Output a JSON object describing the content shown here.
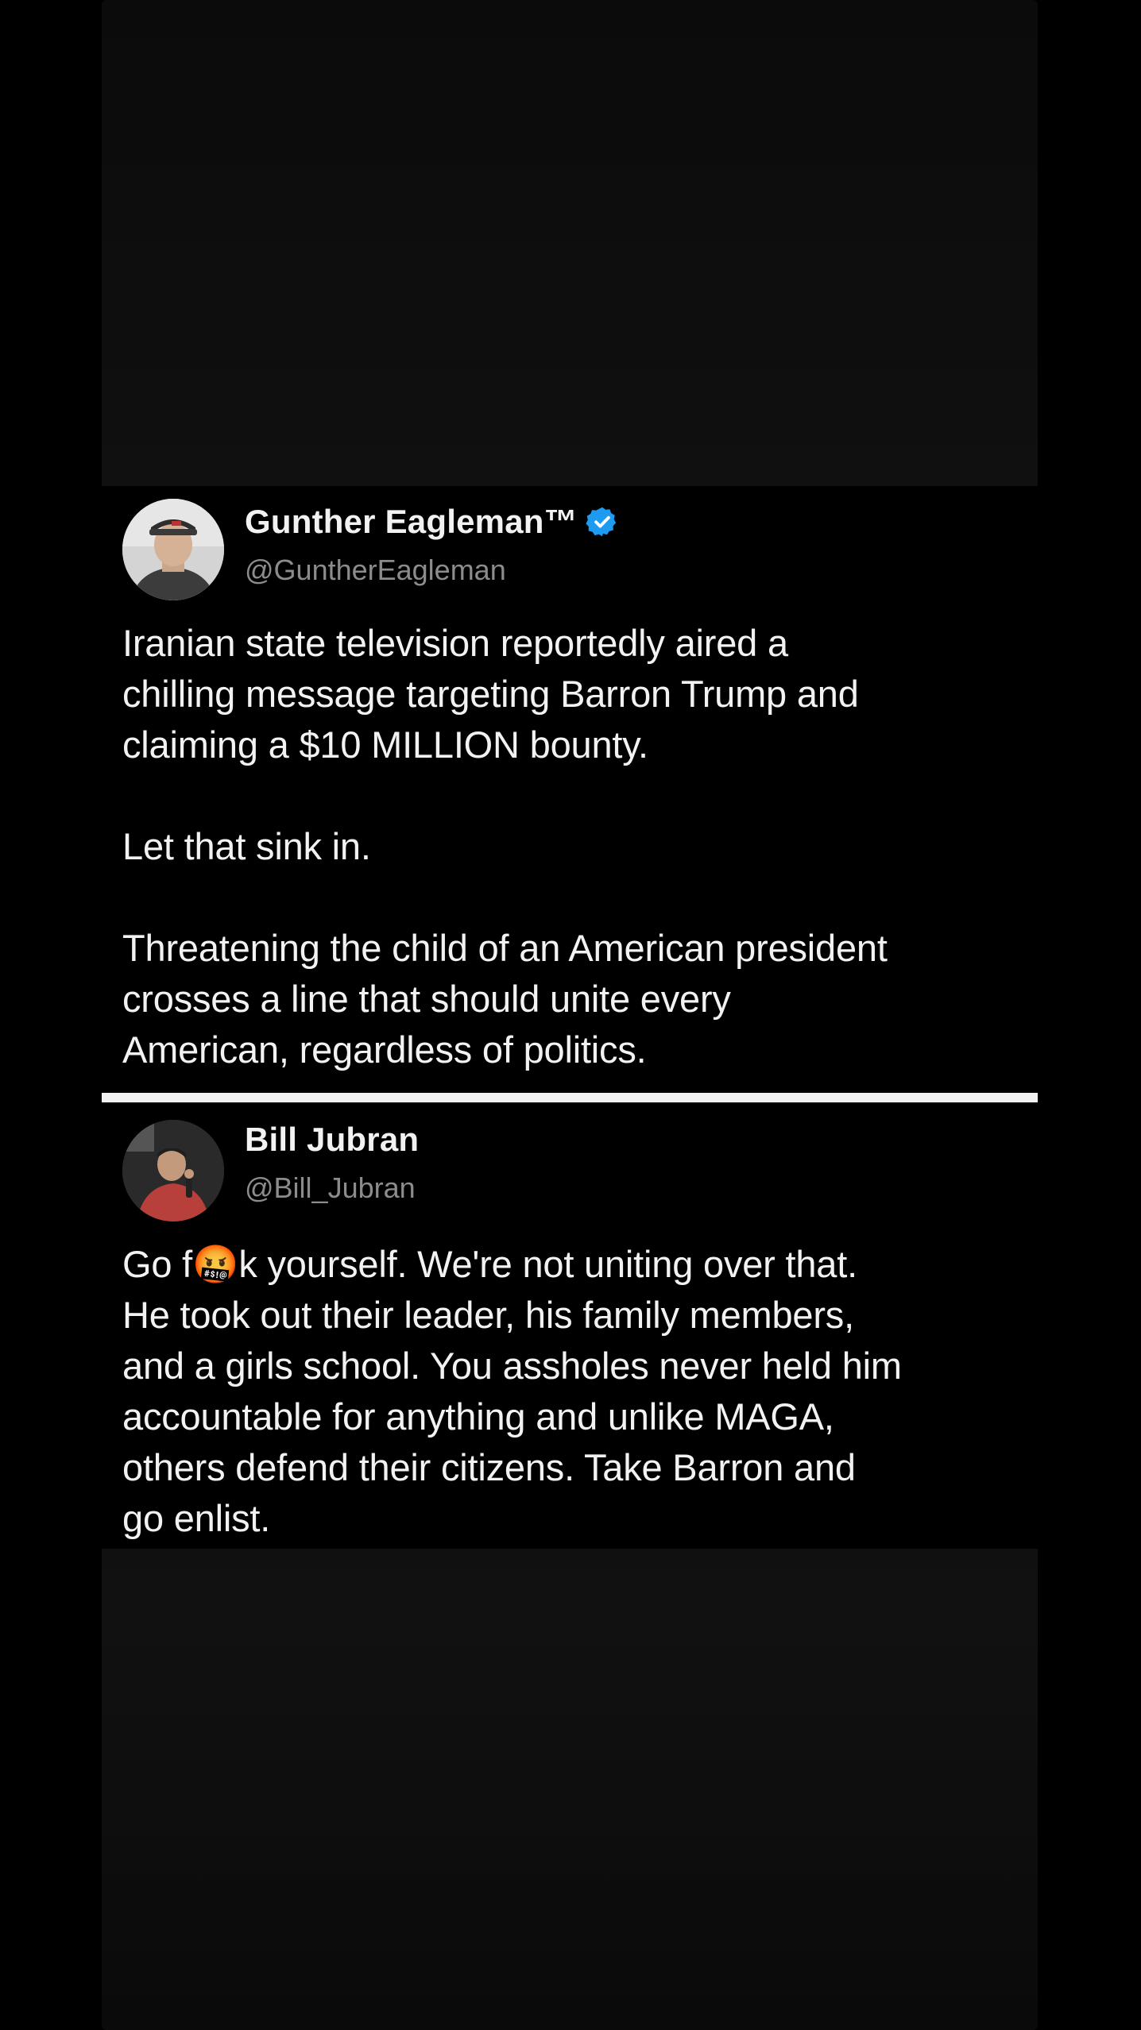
{
  "colors": {
    "background": "#000000",
    "text": "#f2f2f2",
    "handle": "#8c8c8c",
    "verified": "#1d9bf0",
    "divider": "#f2f2f2"
  },
  "tweets": [
    {
      "display_name": "Gunther Eagleman™",
      "handle": "@GuntherEagleman",
      "verified": true,
      "paragraphs": [
        "Iranian state television reportedly aired a\nchilling message targeting Barron Trump and\nclaiming a $10 MILLION bounty.",
        "Let that sink in.",
        "Threatening the child of an American president\ncrosses a line that should unite every\nAmerican, regardless of politics."
      ]
    },
    {
      "display_name": "Bill Jubran",
      "handle": "@Bill_Jubran",
      "verified": false,
      "paragraphs": [
        "Go f🤬k yourself. We're not uniting over that.\nHe took out their leader, his family members,\nand a girls school. You assholes never held him\naccountable for anything and unlike MAGA,\nothers defend their citizens. Take Barron and\ngo enlist."
      ]
    }
  ]
}
